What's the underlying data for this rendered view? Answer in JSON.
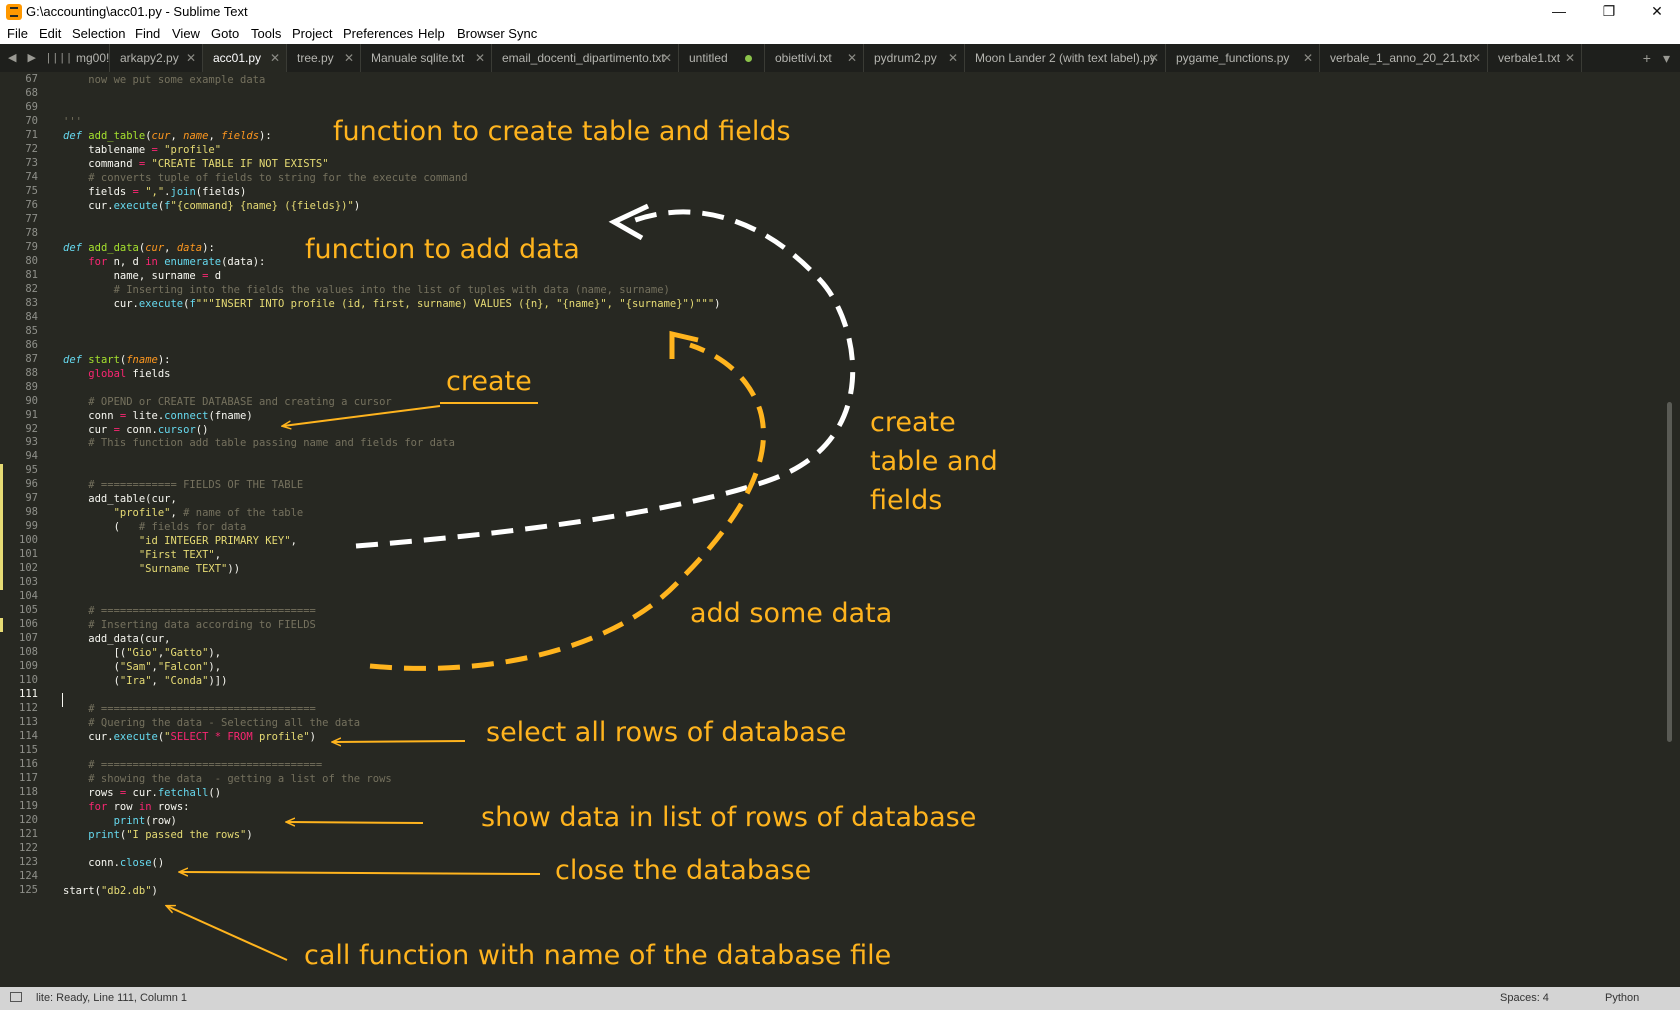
{
  "window": {
    "title": "G:\\accounting\\acc01.py - Sublime Text",
    "controls": [
      "—",
      "❐",
      "✕"
    ]
  },
  "menu": [
    "File",
    "Edit",
    "Selection",
    "Find",
    "View",
    "Goto",
    "Tools",
    "Project",
    "Preferences",
    "Help",
    "Browser Sync"
  ],
  "tabs": [
    {
      "label": "mg00!",
      "state": "partial"
    },
    {
      "label": "arkapy2.py",
      "state": "normal"
    },
    {
      "label": "acc01.py",
      "state": "active"
    },
    {
      "label": "tree.py",
      "state": "normal"
    },
    {
      "label": "Manuale sqlite.txt",
      "state": "normal"
    },
    {
      "label": "email_docenti_dipartimento.txt",
      "state": "normal"
    },
    {
      "label": "untitled",
      "state": "modified"
    },
    {
      "label": "obiettivi.txt",
      "state": "normal"
    },
    {
      "label": "pydrum2.py",
      "state": "normal"
    },
    {
      "label": "Moon Lander 2 (with text label).py",
      "state": "normal"
    },
    {
      "label": "pygame_functions.py",
      "state": "normal"
    },
    {
      "label": "verbale_1_anno_20_21.txt",
      "state": "normal"
    },
    {
      "label": "verbale1.txt",
      "state": "normal"
    }
  ],
  "editor": {
    "first_line_number": 67,
    "current_line": 111,
    "modified_lines": [
      95,
      96,
      97,
      98,
      99,
      100,
      101,
      102,
      103,
      106
    ],
    "lines": [
      [
        [
          "    now we put some example data",
          "com"
        ]
      ],
      [],
      [],
      [
        [
          "'''",
          "com"
        ]
      ],
      [
        [
          "def ",
          "kw"
        ],
        [
          "add_table",
          "fn"
        ],
        [
          "(",
          "n"
        ],
        [
          "cur",
          "par"
        ],
        [
          ", ",
          "n"
        ],
        [
          "name",
          "par"
        ],
        [
          ", ",
          "n"
        ],
        [
          "fields",
          "par"
        ],
        [
          "):",
          "n"
        ]
      ],
      [
        [
          "    tablename ",
          "n"
        ],
        [
          "=",
          "op"
        ],
        [
          " ",
          "n"
        ],
        [
          "\"profile\"",
          "str"
        ]
      ],
      [
        [
          "    command ",
          "n"
        ],
        [
          "=",
          "op"
        ],
        [
          " ",
          "n"
        ],
        [
          "\"CREATE TABLE IF NOT EXISTS\"",
          "str"
        ]
      ],
      [
        [
          "    # converts tuple of fields to string for the execute command",
          "com"
        ]
      ],
      [
        [
          "    fields ",
          "n"
        ],
        [
          "=",
          "op"
        ],
        [
          " ",
          "n"
        ],
        [
          "\",\"",
          "str"
        ],
        [
          ".",
          "n"
        ],
        [
          "join",
          "bi"
        ],
        [
          "(fields)",
          "n"
        ]
      ],
      [
        [
          "    cur.",
          "n"
        ],
        [
          "execute",
          "bi"
        ],
        [
          "(",
          "n"
        ],
        [
          "f",
          "bi"
        ],
        [
          "\"{command} {name} ({fields})\"",
          "str"
        ],
        [
          ")",
          "n"
        ]
      ],
      [],
      [],
      [
        [
          "def ",
          "kw"
        ],
        [
          "add_data",
          "fn"
        ],
        [
          "(",
          "n"
        ],
        [
          "cur",
          "par"
        ],
        [
          ", ",
          "n"
        ],
        [
          "data",
          "par"
        ],
        [
          "):",
          "n"
        ]
      ],
      [
        [
          "    ",
          "n"
        ],
        [
          "for",
          "op"
        ],
        [
          " n, d ",
          "n"
        ],
        [
          "in",
          "op"
        ],
        [
          " ",
          "n"
        ],
        [
          "enumerate",
          "bi"
        ],
        [
          "(data):",
          "n"
        ]
      ],
      [
        [
          "        name, surname ",
          "n"
        ],
        [
          "=",
          "op"
        ],
        [
          " d",
          "n"
        ]
      ],
      [
        [
          "        # Inserting into the fields the values into the list of tuples with data (name, surname)",
          "com"
        ]
      ],
      [
        [
          "        cur.",
          "n"
        ],
        [
          "execute",
          "bi"
        ],
        [
          "(",
          "n"
        ],
        [
          "f",
          "bi"
        ],
        [
          "\"\"\"INSERT INTO profile (id, first, surname) VALUES ({n}, \"{name}\", \"{surname}\")\"\"\"",
          "str"
        ],
        [
          ")",
          "n"
        ]
      ],
      [],
      [],
      [],
      [
        [
          "def ",
          "kw"
        ],
        [
          "start",
          "fn"
        ],
        [
          "(",
          "n"
        ],
        [
          "fname",
          "par"
        ],
        [
          "):",
          "n"
        ]
      ],
      [
        [
          "    ",
          "n"
        ],
        [
          "global",
          "op"
        ],
        [
          " fields",
          "n"
        ]
      ],
      [],
      [
        [
          "    # OPEND or CREATE DATABASE and creating a cursor",
          "com"
        ]
      ],
      [
        [
          "    conn ",
          "n"
        ],
        [
          "=",
          "op"
        ],
        [
          " lite.",
          "n"
        ],
        [
          "connect",
          "bi"
        ],
        [
          "(fname)",
          "n"
        ]
      ],
      [
        [
          "    cur ",
          "n"
        ],
        [
          "=",
          "op"
        ],
        [
          " conn.",
          "n"
        ],
        [
          "cursor",
          "bi"
        ],
        [
          "()",
          "n"
        ]
      ],
      [
        [
          "    # This function add table passing name and fields for data",
          "com"
        ]
      ],
      [],
      [],
      [
        [
          "    # ============ FIELDS OF THE TABLE",
          "com"
        ]
      ],
      [
        [
          "    add_table(cur,",
          "n"
        ]
      ],
      [
        [
          "        ",
          "n"
        ],
        [
          "\"profile\"",
          "str"
        ],
        [
          ", ",
          "n"
        ],
        [
          "# name of the table",
          "com"
        ]
      ],
      [
        [
          "        (   ",
          "n"
        ],
        [
          "# fields for data",
          "com"
        ]
      ],
      [
        [
          "            ",
          "n"
        ],
        [
          "\"id INTEGER PRIMARY KEY\"",
          "str"
        ],
        [
          ",",
          "n"
        ]
      ],
      [
        [
          "            ",
          "n"
        ],
        [
          "\"First TEXT\"",
          "str"
        ],
        [
          ",",
          "n"
        ]
      ],
      [
        [
          "            ",
          "n"
        ],
        [
          "\"Surname TEXT\"",
          "str"
        ],
        [
          "))",
          "n"
        ]
      ],
      [],
      [],
      [
        [
          "    # ==================================",
          "com"
        ]
      ],
      [
        [
          "    # Inserting data according to FIELDS",
          "com"
        ]
      ],
      [
        [
          "    add_data(cur,",
          "n"
        ]
      ],
      [
        [
          "        [(",
          "n"
        ],
        [
          "\"Gio\"",
          "str"
        ],
        [
          ",",
          "n"
        ],
        [
          "\"Gatto\"",
          "str"
        ],
        [
          "),",
          "n"
        ]
      ],
      [
        [
          "        (",
          "n"
        ],
        [
          "\"Sam\"",
          "str"
        ],
        [
          ",",
          "n"
        ],
        [
          "\"Falcon\"",
          "str"
        ],
        [
          "),",
          "n"
        ]
      ],
      [
        [
          "        (",
          "n"
        ],
        [
          "\"Ira\"",
          "str"
        ],
        [
          ", ",
          "n"
        ],
        [
          "\"Conda\"",
          "str"
        ],
        [
          ")])",
          "n"
        ]
      ],
      [],
      [
        [
          "    # ==================================",
          "com"
        ]
      ],
      [
        [
          "    # Quering the data - Selecting all the data",
          "com"
        ]
      ],
      [
        [
          "    cur.",
          "n"
        ],
        [
          "execute",
          "bi"
        ],
        [
          "(",
          "n"
        ],
        [
          "\"",
          "str"
        ],
        [
          "SELECT * FROM",
          "red"
        ],
        [
          " profile\"",
          "str"
        ],
        [
          ")",
          "n"
        ]
      ],
      [],
      [
        [
          "    # ===================================",
          "com"
        ]
      ],
      [
        [
          "    # showing the data  - getting a list of the rows",
          "com"
        ]
      ],
      [
        [
          "    rows ",
          "n"
        ],
        [
          "=",
          "op"
        ],
        [
          " cur.",
          "n"
        ],
        [
          "fetchall",
          "bi"
        ],
        [
          "()",
          "n"
        ]
      ],
      [
        [
          "    ",
          "n"
        ],
        [
          "for",
          "op"
        ],
        [
          " row ",
          "n"
        ],
        [
          "in",
          "op"
        ],
        [
          " rows:",
          "n"
        ]
      ],
      [
        [
          "        ",
          "n"
        ],
        [
          "print",
          "bi"
        ],
        [
          "(row)",
          "n"
        ]
      ],
      [
        [
          "    ",
          "n"
        ],
        [
          "print",
          "bi"
        ],
        [
          "(",
          "n"
        ],
        [
          "\"I passed the rows\"",
          "str"
        ],
        [
          ")",
          "n"
        ]
      ],
      [],
      [
        [
          "    conn.",
          "n"
        ],
        [
          "close",
          "bi"
        ],
        [
          "()",
          "n"
        ]
      ],
      [],
      [
        [
          "start(",
          "n"
        ],
        [
          "\"db2.db\"",
          "str"
        ],
        [
          ")",
          "n"
        ]
      ]
    ]
  },
  "annotations": [
    {
      "id": "anno-create-table-function",
      "text": "function to create table and fields"
    },
    {
      "id": "anno-add-data-function",
      "text": "function to add data"
    },
    {
      "id": "anno-create",
      "text": "create"
    },
    {
      "id": "anno-create-table-fields-1",
      "text": "create"
    },
    {
      "id": "anno-create-table-fields-2",
      "text": "table and"
    },
    {
      "id": "anno-create-table-fields-3",
      "text": "fields"
    },
    {
      "id": "anno-add-some-data",
      "text": "add some data"
    },
    {
      "id": "anno-select-rows",
      "text": "select all rows of database"
    },
    {
      "id": "anno-show-data",
      "text": "show data in list of rows of database"
    },
    {
      "id": "anno-close-db",
      "text": "close the database"
    },
    {
      "id": "anno-call-function",
      "text": "call function with name of the database file"
    }
  ],
  "annotation_color": "#ffb41e",
  "status": {
    "message": "lite: Ready, Line 111, Column 1",
    "spaces": "Spaces: 4",
    "syntax": "Python"
  },
  "colors": {
    "background": "#272822",
    "keyword": "#66d9ef",
    "function": "#a6e22e",
    "string": "#e6db74",
    "comment": "#75715e",
    "operator": "#f92672",
    "parameter": "#fd971f"
  }
}
